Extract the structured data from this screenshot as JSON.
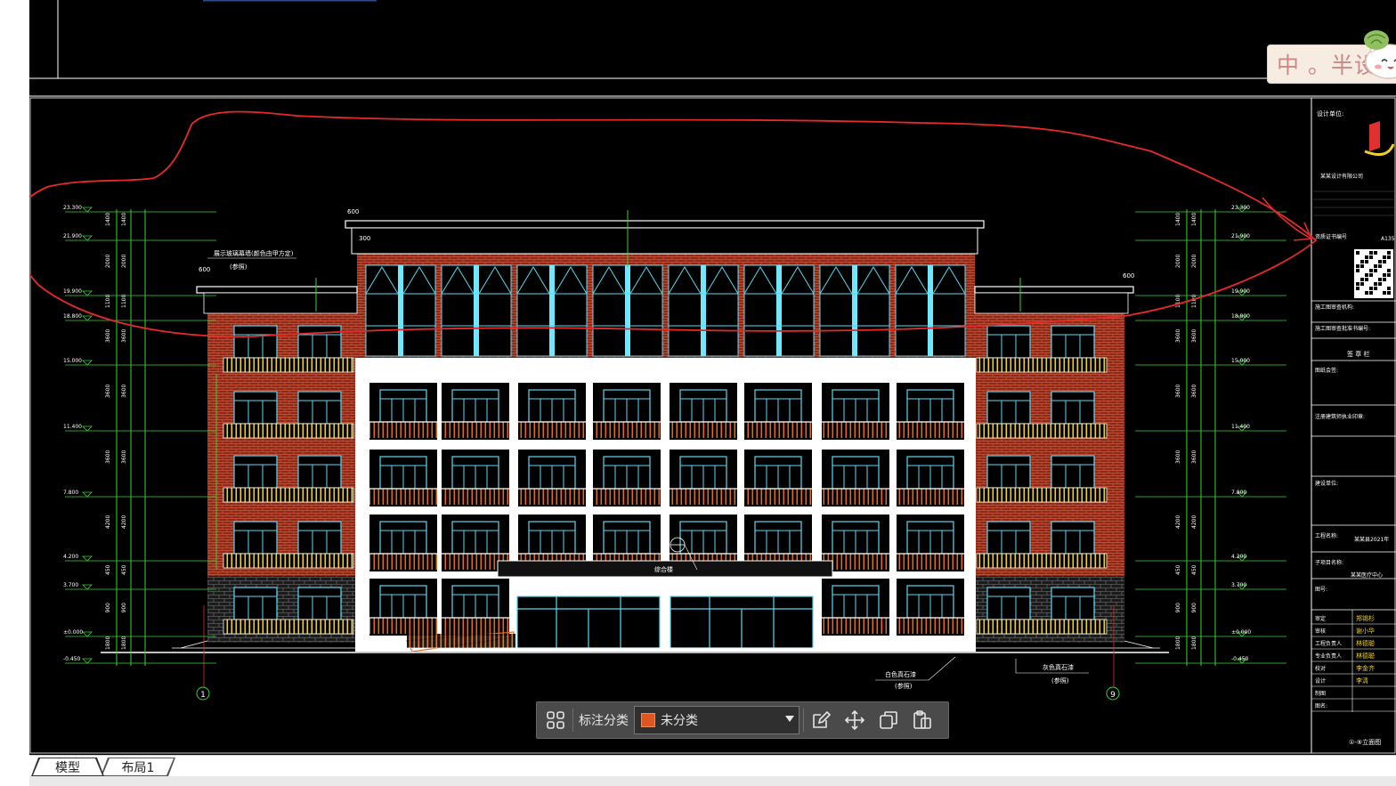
{
  "watermark": {
    "text": "中 。半设"
  },
  "toolbar": {
    "label": "标注分类",
    "category_value": "未分类",
    "swatch_color": "#e0561f",
    "icons": [
      "grid-icon",
      "edit-icon",
      "move-icon",
      "copy-icon",
      "paste-icon"
    ]
  },
  "tabs": [
    {
      "label": "模型",
      "active": true
    },
    {
      "label": "布局1",
      "active": false
    }
  ],
  "drawing": {
    "levels_left": [
      "23.300",
      "21.900",
      "19.900",
      "18.800",
      "15.000",
      "11.400",
      "7.800",
      "4.200",
      "3.700",
      "±0.000",
      "-0.450"
    ],
    "levels_right": [
      "23.300",
      "21.900",
      "19.900",
      "18.800",
      "15.000",
      "11.400",
      "7.800",
      "4.200",
      "3.700",
      "±0.000",
      "-0.450"
    ],
    "dims": [
      "1400",
      "2000",
      "1100",
      "3600",
      "3600",
      "3600",
      "4200",
      "450",
      "900",
      "1800"
    ],
    "annotations": {
      "note_top_left_1": "展示玻璃幕墙(颜色由甲方定)",
      "note_top_left_2": "(参照)",
      "door_sign": "综合楼",
      "note_bottom_1": "白色真石漆",
      "note_bottom_1b": "(参照)",
      "note_bottom_2": "灰色真石漆",
      "note_bottom_2b": "(参照)",
      "axis_left": "1",
      "axis_right": "9",
      "top_dim_a": "600",
      "top_dim_b": "300",
      "side_dim": "600"
    },
    "title_block": {
      "design_unit_label": "设计单位:",
      "company": "某某设计有限公司",
      "cert_label": "资质证书编号",
      "cert_value": "A135",
      "construction_label": "施工图审查机构:",
      "construction_no": "施工图审查批准书编号:",
      "seal_label": "签 章 栏",
      "plan_label": "图纸会签:",
      "stamp_label": "注册建筑师执业印章:",
      "owner_label": "建设单位:",
      "project_label": "工程名称:",
      "project_value": "某某县2021年",
      "subproject_label": "子项目名称:",
      "subproject_value": "某某医疗中心",
      "drawing_label": "图号:",
      "roles": [
        {
          "role": "审定",
          "name": "郑锡杉"
        },
        {
          "role": "审核",
          "name": "谢小华"
        },
        {
          "role": "工程负责人",
          "name": "林德聪"
        },
        {
          "role": "专业负责人",
          "name": "林德聪"
        },
        {
          "role": "校对",
          "name": "李金齐"
        },
        {
          "role": "设计",
          "name": "李清"
        },
        {
          "role": "制图",
          "name": ""
        },
        {
          "role": "图名:",
          "name": ""
        }
      ],
      "sheet_title": "①-⑨立面图"
    }
  }
}
